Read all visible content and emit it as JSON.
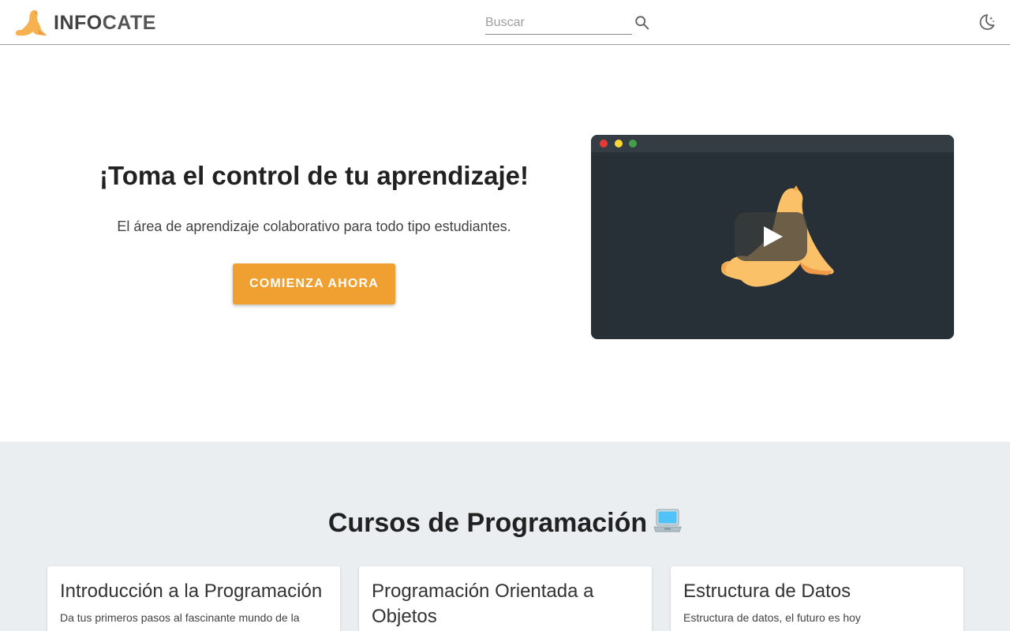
{
  "header": {
    "brand_prefix": "INFO",
    "brand_suffix": "CATE",
    "search_placeholder": "Buscar",
    "icons": [
      "seal-logo-icon",
      "search-icon",
      "moon-icon"
    ]
  },
  "hero": {
    "title": "¡Toma el control de tu aprendizaje!",
    "subtitle": "El área de aprendizaje colaborativo para todo tipo estudiantes.",
    "cta_label": "COMIENZA AHORA"
  },
  "courses": {
    "title": "Cursos de Programación",
    "items": [
      {
        "title": "Introducción a la Programación",
        "description": "Da tus primeros pasos al fascinante mundo de la"
      },
      {
        "title": "Programación Orientada a Objetos",
        "description": ""
      },
      {
        "title": "Estructura de Datos",
        "description": "Estructura de datos, el futuro es hoy"
      }
    ]
  },
  "colors": {
    "accent": "#f0a030",
    "video_bg": "#263036",
    "section_bg": "#eaeef1"
  }
}
